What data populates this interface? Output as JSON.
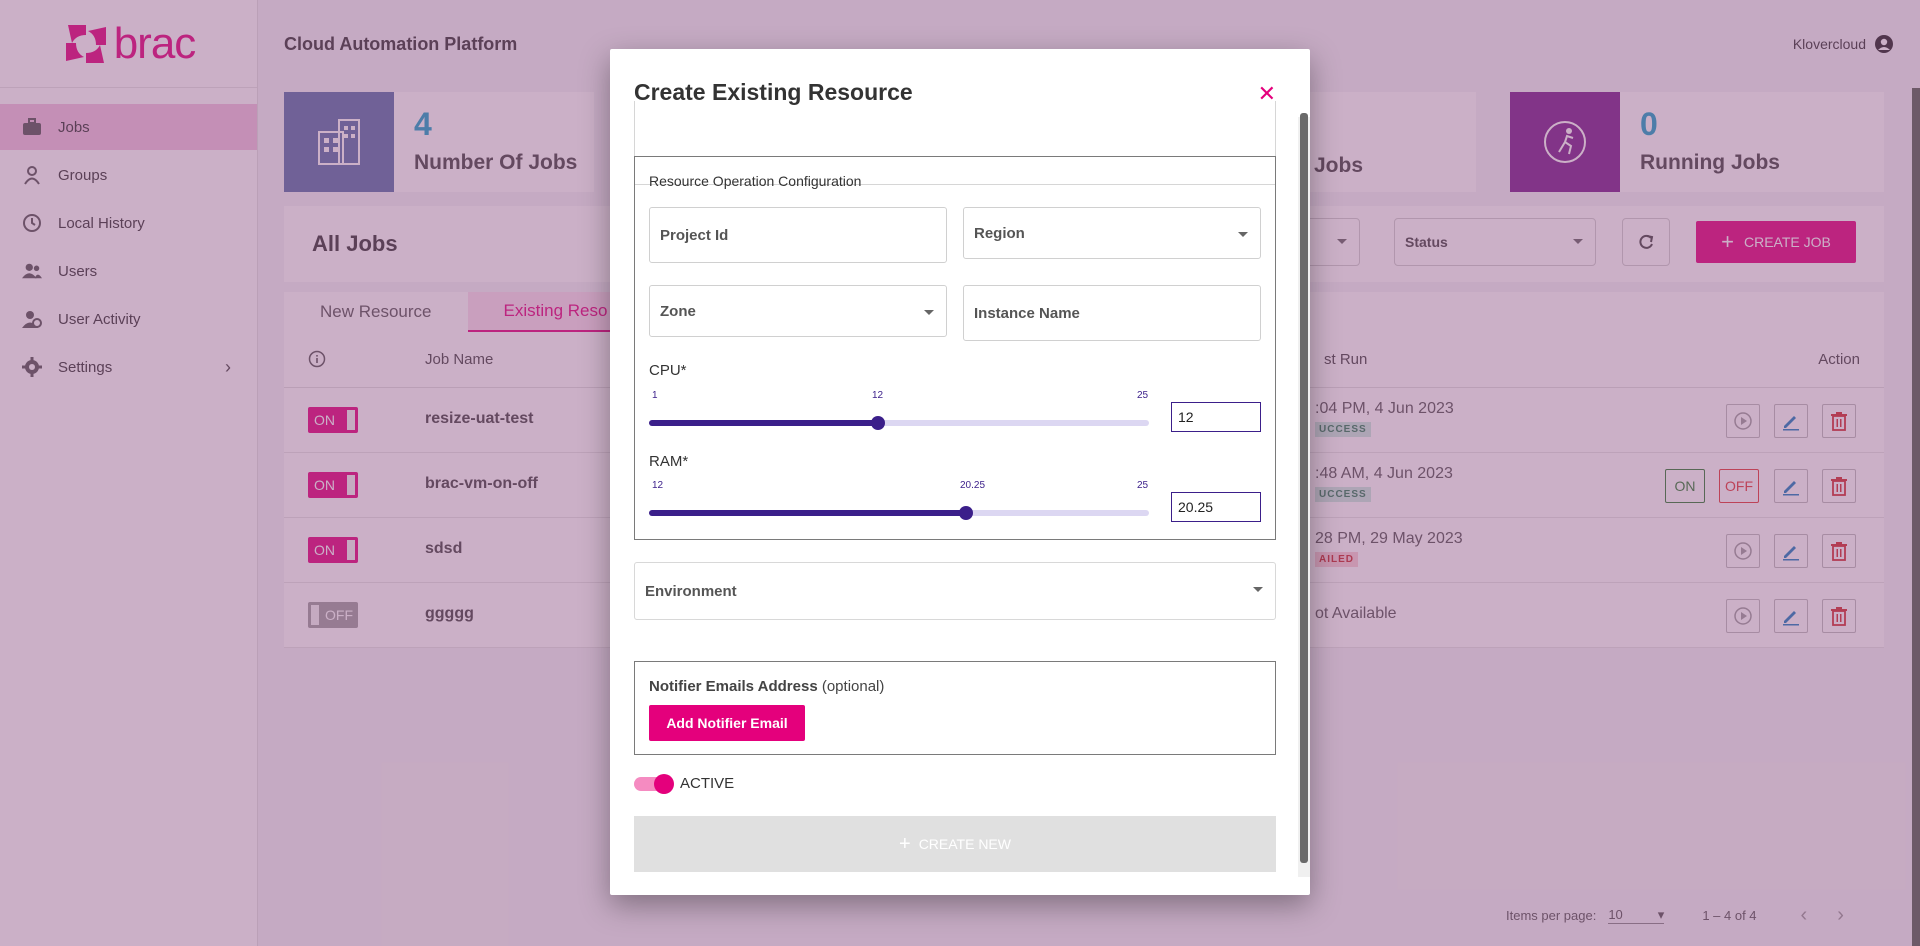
{
  "brand": {
    "logo_text": "brac",
    "accent": "#e4007c"
  },
  "sidebar": {
    "items": [
      {
        "label": "Jobs",
        "icon": "briefcase-icon",
        "active": true
      },
      {
        "label": "Groups",
        "icon": "groups-icon"
      },
      {
        "label": "Local History",
        "icon": "history-icon"
      },
      {
        "label": "Users",
        "icon": "users-icon"
      },
      {
        "label": "User Activity",
        "icon": "user-activity-icon"
      },
      {
        "label": "Settings",
        "icon": "gear-icon"
      }
    ]
  },
  "topbar": {
    "title": "Cloud Automation Platform",
    "user": "Klovercloud"
  },
  "stats": [
    {
      "value": "4",
      "label": "Number Of Jobs"
    },
    {
      "value": "",
      "label": "Jobs"
    },
    {
      "value": "0",
      "label": "Running Jobs"
    }
  ],
  "jobs_panel": {
    "title": "All Jobs",
    "status_filter": "Status",
    "create_job": "CREATE JOB",
    "tabs": [
      "New Resource",
      "Existing Reso"
    ],
    "columns": {
      "job_name": "Job Name",
      "last_run": "st Run",
      "action": "Action"
    },
    "rows": [
      {
        "state": "ON",
        "name": "resize-uat-test",
        "last_run": ":04 PM, 4 Jun 2023",
        "status": "UCCESS"
      },
      {
        "state": "ON",
        "name": "brac-vm-on-off",
        "last_run": ":48 AM, 4 Jun 2023",
        "status": "UCCESS",
        "on_label": "ON",
        "off_label": "OFF"
      },
      {
        "state": "ON",
        "name": "sdsd",
        "last_run": "28 PM, 29 May 2023",
        "status": "AILED"
      },
      {
        "state": "OFF",
        "name": "ggggg",
        "last_run": "ot Available",
        "status": ""
      }
    ],
    "pager": {
      "items_per_page_label": "Items per page:",
      "items_per_page": "10",
      "range": "1 – 4 of 4"
    }
  },
  "modal": {
    "title": "Create Existing Resource",
    "config": {
      "title": "Resource Operation Configuration",
      "project_id": "Project Id",
      "region": "Region",
      "zone": "Zone",
      "instance_name": "Instance Name",
      "cpu": {
        "label": "CPU*",
        "min": "1",
        "max": "25",
        "value": "12",
        "value_num": 12
      },
      "ram": {
        "label": "RAM*",
        "min": "12",
        "max": "25",
        "value": "20.25",
        "value_num": 20.25
      }
    },
    "environment": "Environment",
    "notifier": {
      "title": "Notifier Emails Address",
      "optional": "(optional)",
      "add_button": "Add Notifier Email"
    },
    "active_label": "ACTIVE",
    "submit": "CREATE NEW"
  }
}
